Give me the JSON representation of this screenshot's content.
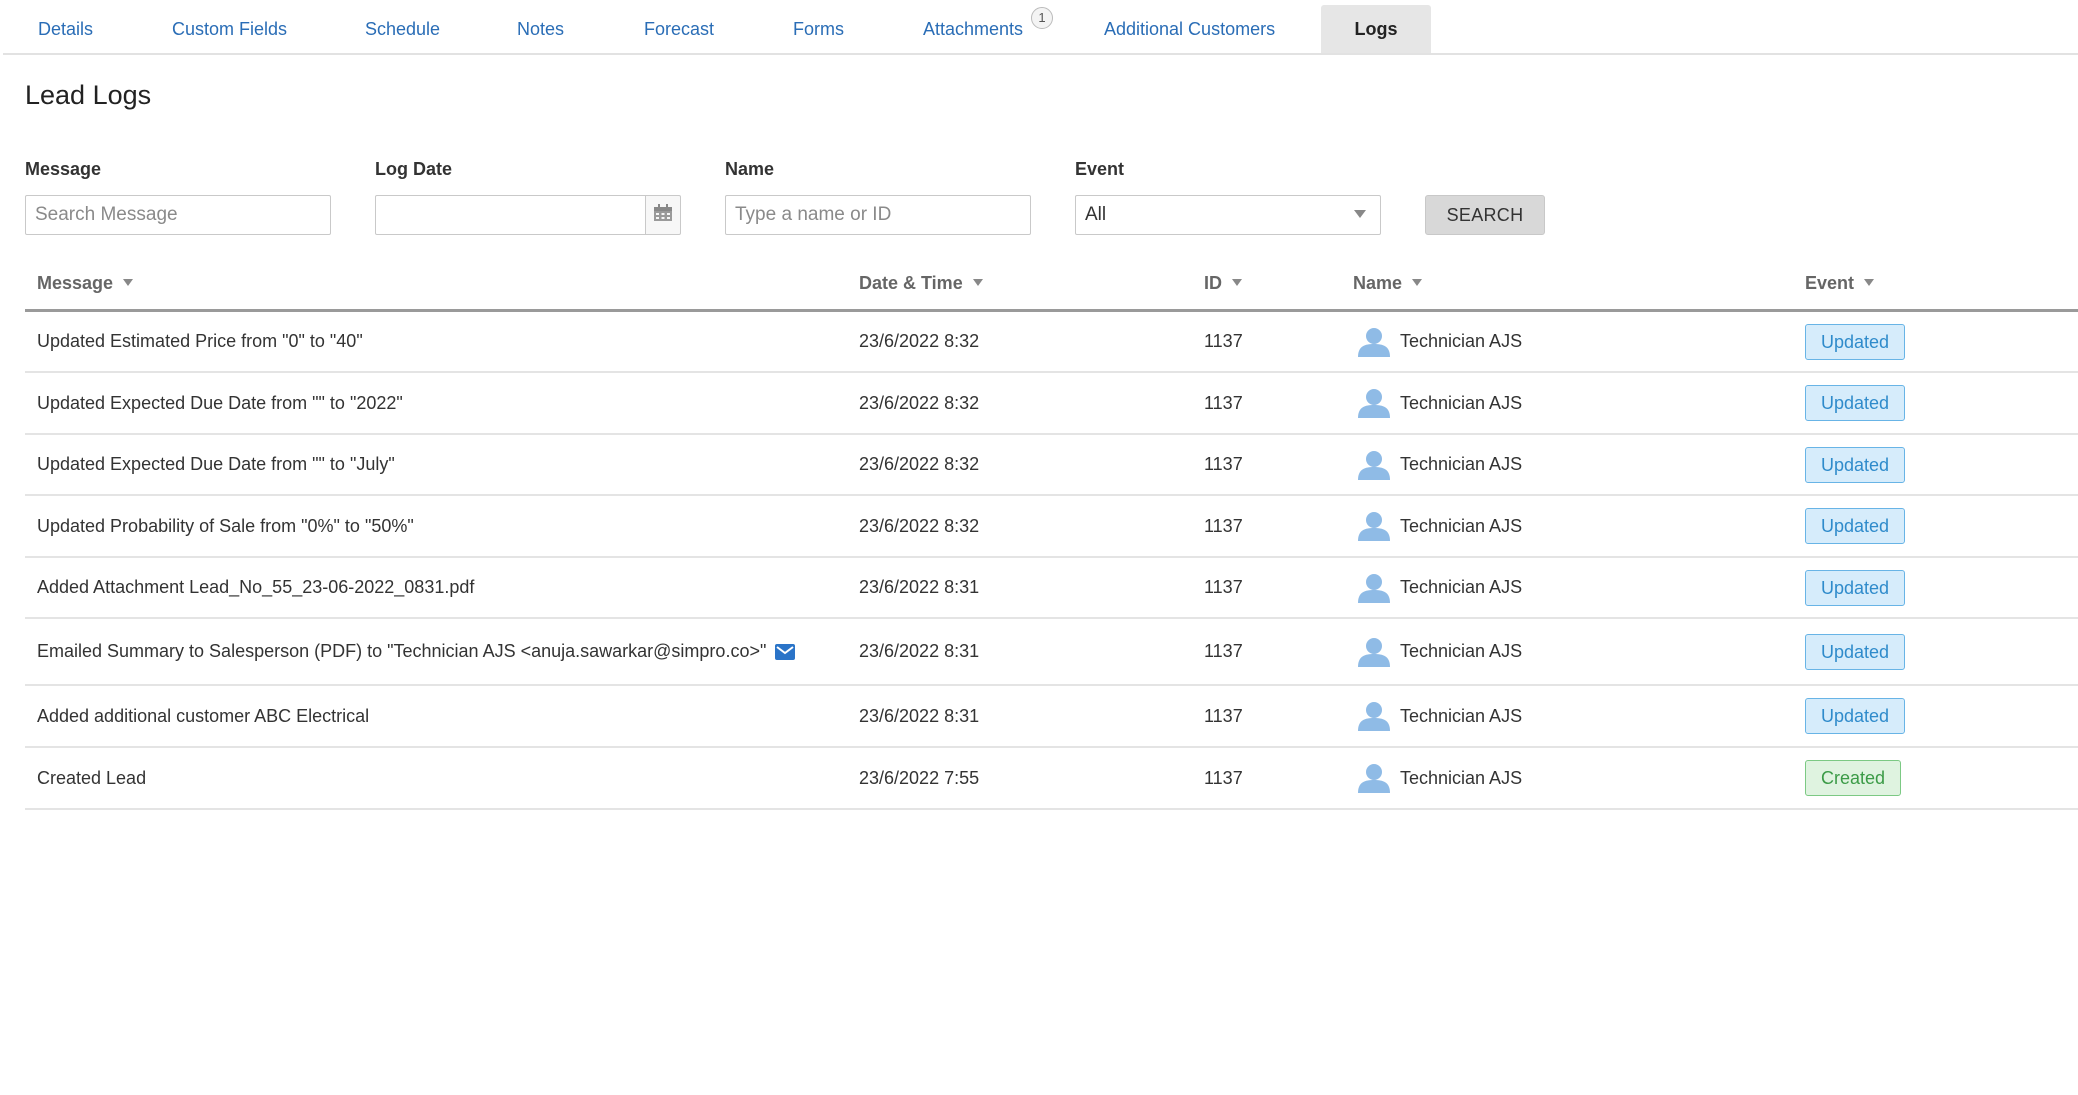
{
  "tabs": [
    {
      "label": "Details"
    },
    {
      "label": "Custom Fields"
    },
    {
      "label": "Schedule"
    },
    {
      "label": "Notes"
    },
    {
      "label": "Forecast"
    },
    {
      "label": "Forms"
    },
    {
      "label": "Attachments",
      "badge": "1"
    },
    {
      "label": "Additional Customers"
    },
    {
      "label": "Logs",
      "active": true
    }
  ],
  "page_title": "Lead Logs",
  "filters": {
    "message": {
      "label": "Message",
      "placeholder": "Search Message",
      "value": ""
    },
    "log_date": {
      "label": "Log Date",
      "value": ""
    },
    "name": {
      "label": "Name",
      "placeholder": "Type a name or ID",
      "value": ""
    },
    "event": {
      "label": "Event",
      "selected": "All"
    },
    "search_label": "SEARCH"
  },
  "table": {
    "columns": [
      "Message",
      "Date & Time",
      "ID",
      "Name",
      "Event"
    ],
    "rows": [
      {
        "message": "Updated Estimated Price from \"0\" to \"40\"",
        "datetime": "23/6/2022 8:32",
        "id": "1137",
        "name": "Technician AJS",
        "event": "Updated"
      },
      {
        "message": "Updated Expected Due Date from \"\" to \"2022\"",
        "datetime": "23/6/2022 8:32",
        "id": "1137",
        "name": "Technician AJS",
        "event": "Updated"
      },
      {
        "message": "Updated Expected Due Date from \"\" to \"July\"",
        "datetime": "23/6/2022 8:32",
        "id": "1137",
        "name": "Technician AJS",
        "event": "Updated"
      },
      {
        "message": "Updated Probability of Sale from \"0%\" to \"50%\"",
        "datetime": "23/6/2022 8:32",
        "id": "1137",
        "name": "Technician AJS",
        "event": "Updated"
      },
      {
        "message": "Added Attachment Lead_No_55_23-06-2022_0831.pdf",
        "datetime": "23/6/2022 8:31",
        "id": "1137",
        "name": "Technician AJS",
        "event": "Updated"
      },
      {
        "message": "Emailed Summary to Salesperson (PDF) to \"Technician AJS <anuja.sawarkar@simpro.co>\"",
        "datetime": "23/6/2022 8:31",
        "id": "1137",
        "name": "Technician AJS",
        "event": "Updated",
        "icon": "mail-icon"
      },
      {
        "message": "Added additional customer ABC Electrical",
        "datetime": "23/6/2022 8:31",
        "id": "1137",
        "name": "Technician AJS",
        "event": "Updated"
      },
      {
        "message": "Created Lead",
        "datetime": "23/6/2022 7:55",
        "id": "1137",
        "name": "Technician AJS",
        "event": "Created"
      }
    ]
  },
  "colors": {
    "link": "#2a6db6",
    "updated_bg": "#d6ecfb",
    "updated_border": "#68b4e6",
    "created_bg": "#dff3e0",
    "created_border": "#7cc984",
    "avatar": "#8fbbe6"
  }
}
